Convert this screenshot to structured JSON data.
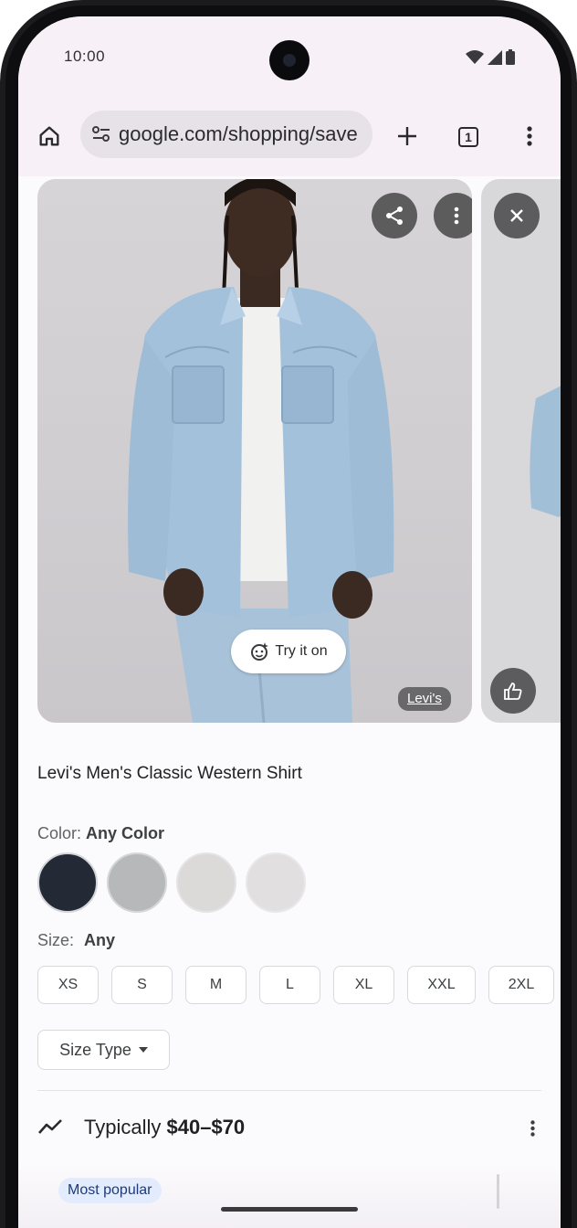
{
  "status_bar": {
    "time": "10:00"
  },
  "browser": {
    "url": "google.com/shopping/save",
    "tab_count": "1"
  },
  "product": {
    "title": "Levi's Men's Classic Western Shirt",
    "brand_tag": "Levi's",
    "try_on_label": "Try it on",
    "color_label": "Color:",
    "color_value": "Any Color",
    "colors": [
      "#242a35",
      "#b7b8b9",
      "#dcd9d9",
      "#e1dfdf"
    ],
    "size_label": "Size:",
    "size_value": "Any",
    "sizes": [
      "XS",
      "S",
      "M",
      "L",
      "XL",
      "XXL",
      "2XL"
    ],
    "size_type_label": "Size Type",
    "price_prefix": "Typically",
    "price_range": "$40–$70",
    "badge": "Most popular"
  },
  "icons": {
    "home": "home-icon",
    "tune": "tune-icon",
    "new_tab": "plus-icon",
    "overflow": "more-vert-icon",
    "share": "share-icon",
    "more": "more-vert-icon",
    "close": "close-icon",
    "like": "thumb-up-icon",
    "try_on": "sparkle-face-icon",
    "trend": "trending-icon",
    "dropdown": "caret-down-icon"
  },
  "colors": {
    "status_bg": "#f7f1f7",
    "url_pill": "#e7e1e8",
    "badge_bg": "#e3ecfd",
    "badge_text": "#1f3a78",
    "button_overlay": "#464648"
  }
}
